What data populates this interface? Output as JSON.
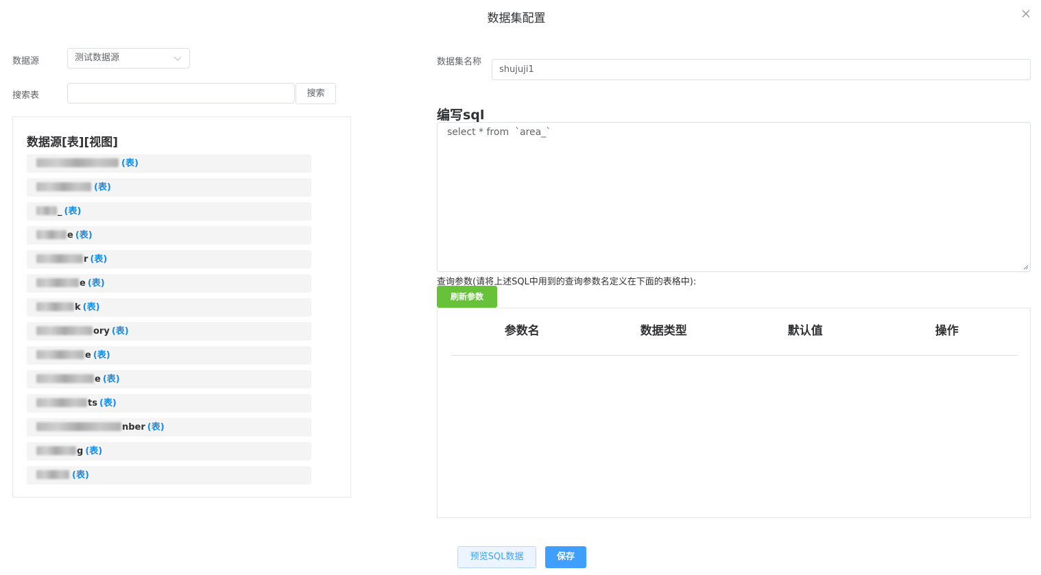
{
  "dialog": {
    "title": "数据集配置",
    "close_icon": "close-icon"
  },
  "left": {
    "datasource_label": "数据源",
    "datasource_value": "测试数据源",
    "search_label": "搜索表",
    "search_value": "",
    "search_button": "搜索",
    "panel_title": "数据源[表][视图]",
    "tables": [
      {
        "blur_width": 120,
        "name_tail": "",
        "tag": "(表)"
      },
      {
        "blur_width": 80,
        "name_tail": "",
        "tag": "(表)"
      },
      {
        "blur_width": 30,
        "name_tail": "_",
        "tag": "(表)"
      },
      {
        "blur_width": 44,
        "name_tail": "e",
        "tag": "(表)"
      },
      {
        "blur_width": 68,
        "name_tail": "r",
        "tag": "(表)"
      },
      {
        "blur_width": 62,
        "name_tail": "e",
        "tag": "(表)"
      },
      {
        "blur_width": 55,
        "name_tail": "k",
        "tag": "(表)"
      },
      {
        "blur_width": 82,
        "name_tail": "ory",
        "tag": "(表)"
      },
      {
        "blur_width": 70,
        "name_tail": "e",
        "tag": "(表)"
      },
      {
        "blur_width": 84,
        "name_tail": "e",
        "tag": "(表)"
      },
      {
        "blur_width": 74,
        "name_tail": "ts",
        "tag": "(表)"
      },
      {
        "blur_width": 124,
        "name_tail": "nber",
        "tag": "(表)"
      },
      {
        "blur_width": 58,
        "name_tail": "g",
        "tag": "(表)"
      },
      {
        "blur_width": 48,
        "name_tail": "",
        "tag": "(表)"
      }
    ]
  },
  "right": {
    "name_label": "数据集名称",
    "name_value": "shujuji1",
    "sql_title": "编写sql",
    "sql_value": "select * from  `area_`",
    "param_hint": "查询参数(请将上述SQL中用到的查询参数名定义在下面的表格中):",
    "refresh_button": "刷新参数",
    "param_columns": [
      "参数名",
      "数据类型",
      "默认值",
      "操作"
    ]
  },
  "footer": {
    "preview_button": "预览SQL数据",
    "save_button": "保存"
  },
  "colors": {
    "primary": "#409eff",
    "success": "#67c23a",
    "tag_blue": "#1989e8"
  }
}
